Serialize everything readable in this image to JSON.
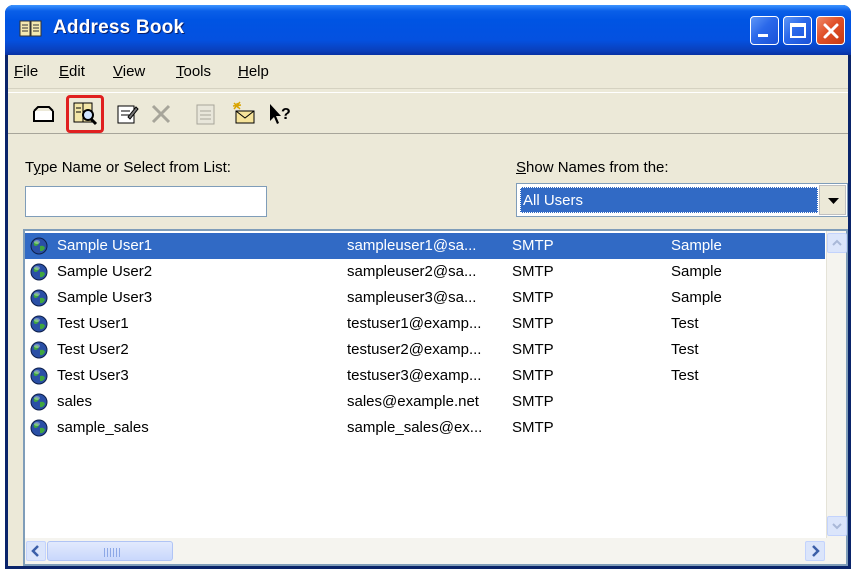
{
  "window": {
    "title": "Address Book"
  },
  "menubar": {
    "items": [
      {
        "label": "File",
        "mnemonic": "F",
        "rest": "ile"
      },
      {
        "label": "Edit",
        "mnemonic": "E",
        "rest": "dit"
      },
      {
        "label": "View",
        "mnemonic": "V",
        "rest": "iew"
      },
      {
        "label": "Tools",
        "mnemonic": "T",
        "rest": "ools"
      },
      {
        "label": "Help",
        "mnemonic": "H",
        "rest": "elp"
      }
    ]
  },
  "toolbar": {
    "tools": [
      {
        "icon": "new-message-icon"
      },
      {
        "icon": "find-items-icon",
        "highlighted": true
      },
      {
        "icon": "properties-icon"
      },
      {
        "icon": "delete-icon"
      },
      {
        "icon": "add-to-contacts-icon"
      },
      {
        "icon": "new-entry-icon"
      },
      {
        "icon": "help-pointer-icon"
      }
    ]
  },
  "search": {
    "label_pre": "T",
    "label_mnemonic": "y",
    "label_post": "pe Name or Select from List:",
    "value": ""
  },
  "show_names": {
    "label_mnemonic": "S",
    "label_post": "how Names from the:",
    "selected": "All Users"
  },
  "list": {
    "rows": [
      {
        "name": "Sample User1",
        "email": "sampleuser1@sa...",
        "type": "SMTP",
        "company": "Sample",
        "selected": true
      },
      {
        "name": "Sample User2",
        "email": "sampleuser2@sa...",
        "type": "SMTP",
        "company": "Sample"
      },
      {
        "name": "Sample User3",
        "email": "sampleuser3@sa...",
        "type": "SMTP",
        "company": "Sample"
      },
      {
        "name": "Test User1",
        "email": "testuser1@examp...",
        "type": "SMTP",
        "company": "Test"
      },
      {
        "name": "Test User2",
        "email": "testuser2@examp...",
        "type": "SMTP",
        "company": "Test"
      },
      {
        "name": "Test User3",
        "email": "testuser3@examp...",
        "type": "SMTP",
        "company": "Test"
      },
      {
        "name": "sales",
        "email": "sales@example.net",
        "type": "SMTP",
        "company": ""
      },
      {
        "name": "sample_sales",
        "email": "sample_sales@ex...",
        "type": "SMTP",
        "company": ""
      }
    ]
  },
  "colors": {
    "titlebar": "#0054e3",
    "selection": "#316ac5",
    "highlight_border": "#e02020",
    "window_face": "#ece9d8"
  }
}
